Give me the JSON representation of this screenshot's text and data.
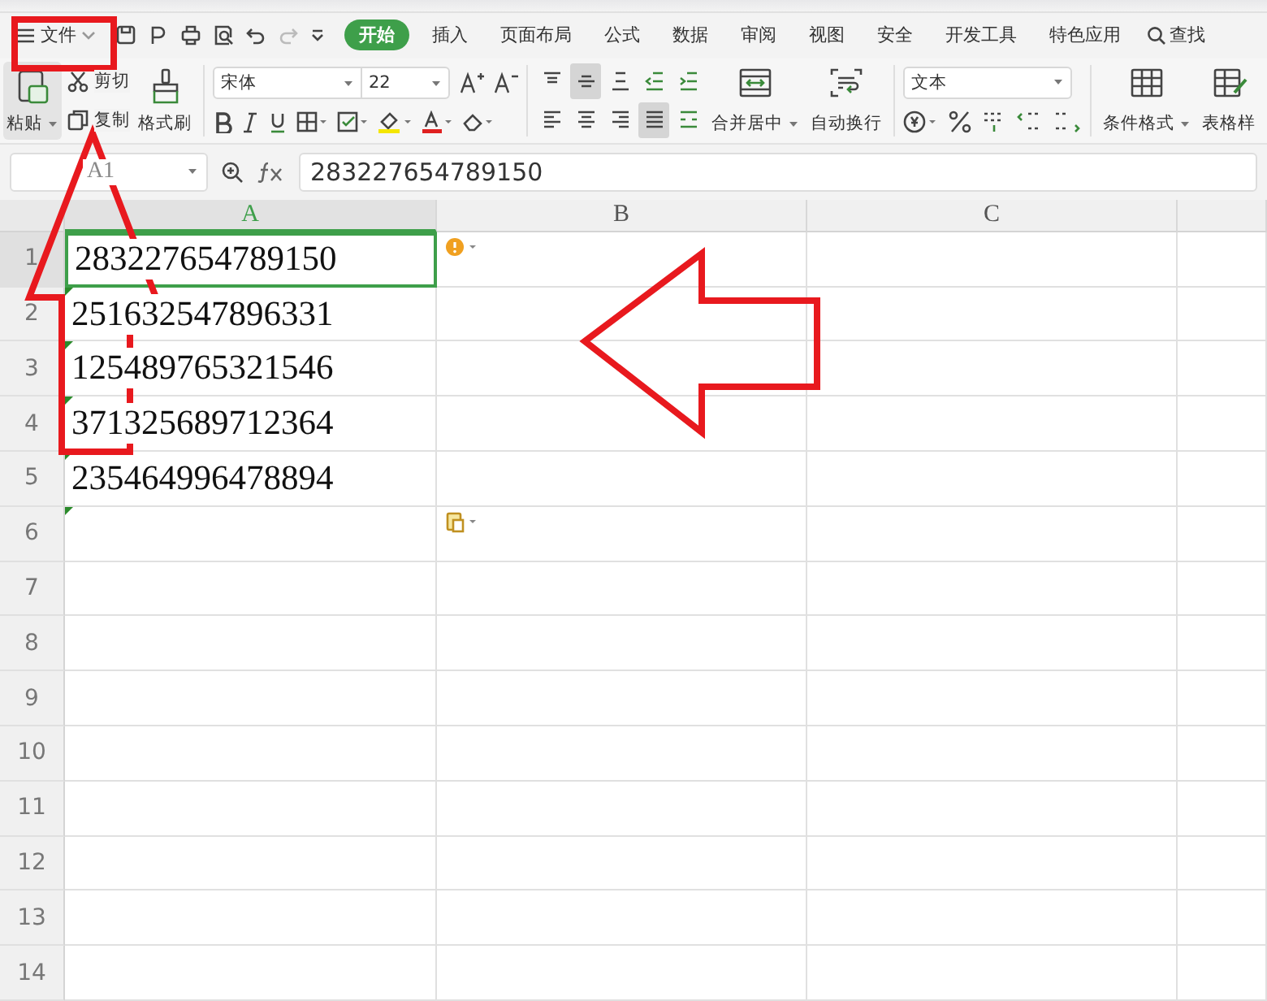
{
  "file_menu": {
    "label": "文件"
  },
  "ribbon_tabs": [
    {
      "label": "开始",
      "selected": true
    },
    {
      "label": "插入",
      "selected": false
    },
    {
      "label": "页面布局",
      "selected": false
    },
    {
      "label": "公式",
      "selected": false
    },
    {
      "label": "数据",
      "selected": false
    },
    {
      "label": "审阅",
      "selected": false
    },
    {
      "label": "视图",
      "selected": false
    },
    {
      "label": "安全",
      "selected": false
    },
    {
      "label": "开发工具",
      "selected": false
    },
    {
      "label": "特色应用",
      "selected": false
    }
  ],
  "search": {
    "label": "查找"
  },
  "clipboard": {
    "paste": "粘贴",
    "cut": "剪切",
    "copy": "复制",
    "format_painter": "格式刷"
  },
  "font": {
    "name": "宋体",
    "size": "22"
  },
  "align_buttons": [
    {
      "kind": "top",
      "selected": false
    },
    {
      "kind": "middle",
      "selected": true
    },
    {
      "kind": "bottom",
      "selected": false
    },
    {
      "kind": "outdent",
      "selected": false
    },
    {
      "kind": "indent",
      "selected": false
    },
    {
      "kind": "left",
      "selected": false
    },
    {
      "kind": "center",
      "selected": false
    },
    {
      "kind": "right",
      "selected": false
    },
    {
      "kind": "justify",
      "selected": true
    },
    {
      "kind": "distributed",
      "selected": false
    }
  ],
  "merge": {
    "label": "合并居中"
  },
  "wrap": {
    "label": "自动换行"
  },
  "number_format": {
    "value": "文本"
  },
  "conditional_format": {
    "label": "条件格式"
  },
  "table_style": {
    "label": "表格样"
  },
  "name_box": {
    "value": "A1"
  },
  "formula_bar": {
    "value": "283227654789150"
  },
  "columns": [
    {
      "label": "A",
      "selected": true
    },
    {
      "label": "B",
      "selected": false
    },
    {
      "label": "C",
      "selected": false
    }
  ],
  "rows": [
    {
      "label": "1",
      "value": "283227654789150",
      "selected": true,
      "text_flag": false
    },
    {
      "label": "2",
      "value": "251632547896331",
      "selected": false,
      "text_flag": true
    },
    {
      "label": "3",
      "value": "125489765321546",
      "selected": false,
      "text_flag": true
    },
    {
      "label": "4",
      "value": "371325689712364",
      "selected": false,
      "text_flag": true
    },
    {
      "label": "5",
      "value": "235464996478894",
      "selected": false,
      "text_flag": true
    },
    {
      "label": "6",
      "selected": false,
      "text_flag": true
    },
    {
      "label": "7",
      "selected": false,
      "text_flag": false
    },
    {
      "label": "8",
      "selected": false,
      "text_flag": false
    },
    {
      "label": "9",
      "selected": false,
      "text_flag": false
    },
    {
      "label": "10",
      "selected": false,
      "text_flag": false
    },
    {
      "label": "11",
      "selected": false,
      "text_flag": false
    },
    {
      "label": "12",
      "selected": false,
      "text_flag": false
    },
    {
      "label": "13",
      "selected": false,
      "text_flag": false
    },
    {
      "label": "14",
      "selected": false,
      "text_flag": false
    }
  ]
}
